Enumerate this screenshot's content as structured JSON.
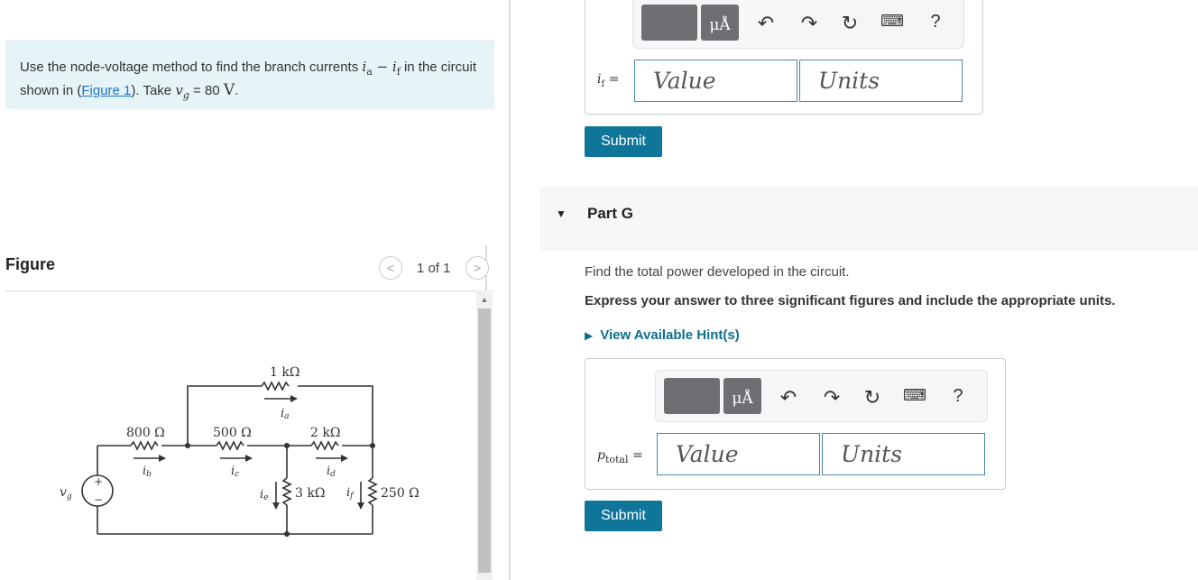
{
  "problem": {
    "text_1": "Use the node-voltage method to find the branch currents ",
    "ia": "i",
    "ia_sub": "a",
    "minus": " − ",
    "if": "i",
    "if_sub": "f",
    "text_2": " in the circuit shown in (",
    "figure_link": "Figure 1",
    "text_3": "). Take ",
    "vg": "v",
    "vg_sub": "g",
    "text_4": " = 80 ",
    "unit": "V",
    "period": "."
  },
  "figure": {
    "title": "Figure",
    "pager": "1 of 1",
    "prev": "<",
    "next": ">"
  },
  "circuit": {
    "r1": "1 kΩ",
    "r800": "800 Ω",
    "r500": "500 Ω",
    "r2k": "2 kΩ",
    "r3k": "3 kΩ",
    "r250": "250 Ω",
    "ia": "i",
    "ia_sub": "a",
    "ib": "i",
    "ib_sub": "b",
    "ic": "i",
    "ic_sub": "c",
    "id": "i",
    "id_sub": "d",
    "ie": "i",
    "ie_sub": "e",
    "if": "i",
    "if_sub": "f",
    "vg": "v",
    "vg_sub": "g",
    "plus": "+",
    "minus": "−"
  },
  "part_f": {
    "var_label": "i",
    "var_sub": "f",
    "equals": "=",
    "value_placeholder": "Value",
    "units_placeholder": "Units",
    "submit_label": "Submit",
    "mu_label": "μÅ",
    "help_label": "?"
  },
  "part_g": {
    "title": "Part G",
    "question": "Find the total power developed in the circuit.",
    "instruction": "Express your answer to three significant figures and include the appropriate units.",
    "hint_label": "View Available Hint(s)",
    "var_label": "p",
    "var_sub": "total",
    "equals": "=",
    "value_placeholder": "Value",
    "units_placeholder": "Units",
    "submit_label": "Submit",
    "mu_label": "μÅ",
    "help_label": "?"
  }
}
